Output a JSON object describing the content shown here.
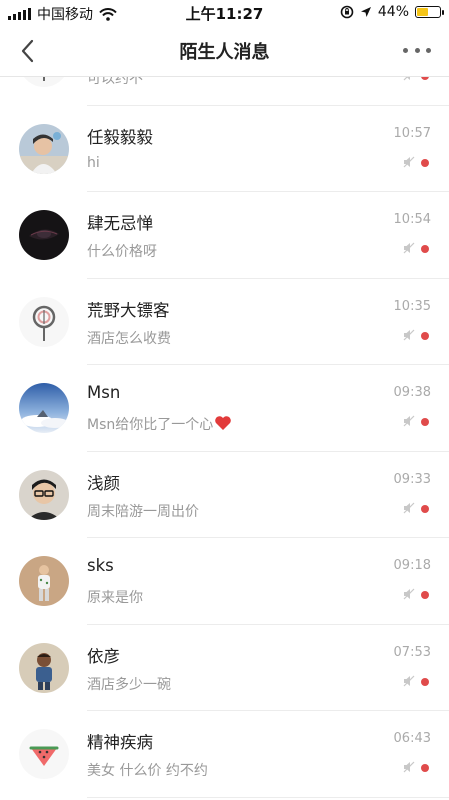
{
  "status_bar": {
    "carrier": "中国移动",
    "time": "上午11:27",
    "battery_percent": "44%",
    "battery_level": 0.44
  },
  "nav": {
    "title": "陌生人消息"
  },
  "conversations": [
    {
      "name": "",
      "message": "可以约不",
      "time": "",
      "avatar": "lollipop-avatar"
    },
    {
      "name": "任毅毅毅",
      "message": "hi",
      "time": "10:57",
      "avatar": "user-photo-avatar"
    },
    {
      "name": "肆无忌惮",
      "message": "什么价格呀",
      "time": "10:54",
      "avatar": "dark-eye-avatar"
    },
    {
      "name": "荒野大镖客",
      "message": "酒店怎么收费",
      "time": "10:35",
      "avatar": "lollipop-avatar"
    },
    {
      "name": "Msn",
      "message": "Msn给你比了一个心",
      "time": "09:38",
      "avatar": "sky-cloud-avatar"
    },
    {
      "name": "浅颜",
      "message": "周末陪游一周出价",
      "time": "09:33",
      "avatar": "man-glasses-avatar"
    },
    {
      "name": "sks",
      "message": "原来是你",
      "time": "09:18",
      "avatar": "person-standing-avatar"
    },
    {
      "name": "依彦",
      "message": "酒店多少一碗",
      "time": "07:53",
      "avatar": "child-avatar"
    },
    {
      "name": "精神疾病",
      "message": "美女 什么价 约不约",
      "time": "06:43",
      "avatar": "watermelon-avatar"
    }
  ],
  "colors": {
    "unread_dot": "#e04b4b",
    "battery": "#f5c518"
  }
}
